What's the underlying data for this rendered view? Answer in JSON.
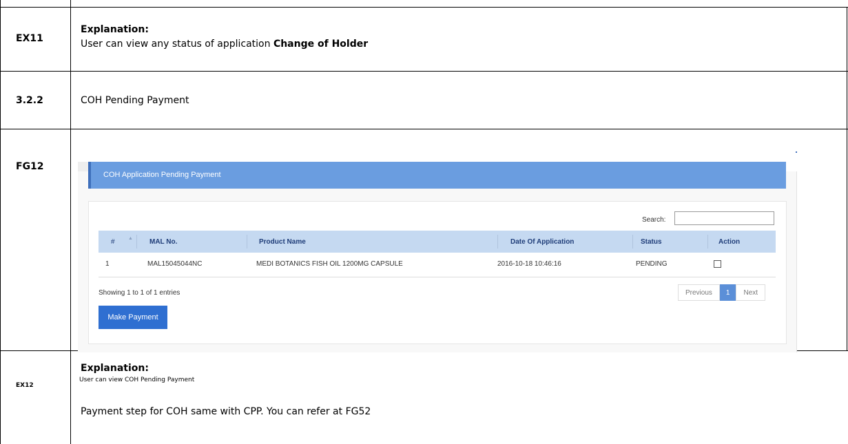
{
  "rows": {
    "ex11": {
      "code": "EX11",
      "heading": "Explanation:",
      "text_prefix": "User can view any status of application ",
      "text_bold": "Change of Holder"
    },
    "section": {
      "code": "3.2.2",
      "title": "COH Pending Payment"
    },
    "fg12": {
      "code": "FG12"
    },
    "ex12": {
      "code": "EX12",
      "heading": "Explanation:",
      "small_text": "User can view COH Pending Payment",
      "text": "Payment step for COH same with CPP. You can refer at FG52"
    }
  },
  "screenshot": {
    "panel_title": "COH Application Pending Payment",
    "search_label": "Search:",
    "search_value": "",
    "columns": [
      "#",
      "MAL No.",
      "Product Name",
      "Date Of Application",
      "Status",
      "Action"
    ],
    "table_rows": [
      {
        "num": "1",
        "mal_no": "MAL15045044NC",
        "product_name": "MEDI BOTANICS FISH OIL 1200MG CAPSULE",
        "date": "2016-10-18 10:46:16",
        "status": "PENDING",
        "action_checked": false
      }
    ],
    "showing_text": "Showing 1 to 1 of 1 entries",
    "pager": {
      "previous": "Previous",
      "current": "1",
      "next": "Next"
    },
    "make_payment_label": "Make Payment"
  },
  "colors": {
    "panel_header": "#6a9de0",
    "table_header": "#c5d9f1",
    "primary_button": "#2f6fd1"
  }
}
